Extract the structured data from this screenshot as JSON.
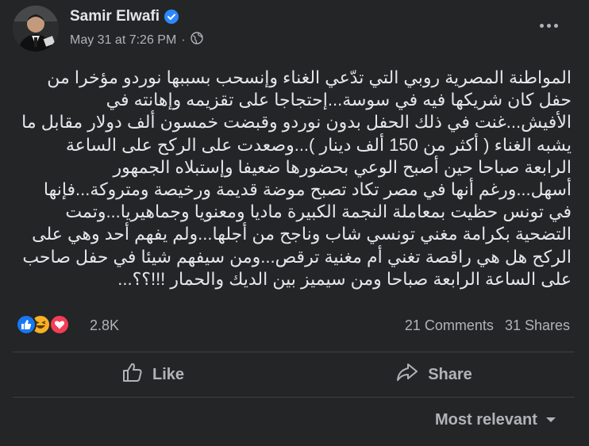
{
  "post": {
    "author": "Samir Elwafi",
    "date": "May 31 at 7:26 PM",
    "separator": "·",
    "text": "المواطنة المصرية روبي التي تدّعي الغناء وإنسحب بسببها نوردو مؤخرا من حفل كان شريكها فيه في سوسة...إحتجاجا على تقزيمه وإهانته في الأفيش...غنت في ذلك الحفل بدون نوردو وقبضت خمسون ألف دولار مقابل ما يشبه الغناء ( أكثر من 150 ألف دينار )...وصعدت على الركح على الساعة الرابعة صباحا حين أصبح الوعي بحضورها ضعيفا وإستبلاه الجمهور أسهل...ورغم أنها في مصر تكاد تصبح موضة قديمة ورخيصة ومتروكة...فإنها في تونس حظيت بمعاملة النجمة الكبيرة ماديا ومعنويا وجماهيريا...وتمت التضحية بكرامة مغني تونسي شاب وناجح من أجلها...ولم يفهم أحد وهي على الركح هل هي راقصة تغني أم مغنية ترقص...ومن سيفهم شيئا في حفل صاحب على الساعة الرابعة صباحا ومن سيميز بين الديك والحمار !!!؟؟..."
  },
  "stats": {
    "reaction_count": "2.8K",
    "comments": "21 Comments",
    "shares": "31 Shares",
    "reactions": [
      "like",
      "haha",
      "love"
    ]
  },
  "actions": {
    "like": "Like",
    "share": "Share"
  },
  "comments_sort": {
    "label": "Most relevant"
  },
  "colors": {
    "background": "#242526",
    "text_primary": "#e4e6eb",
    "text_secondary": "#b0b3b8",
    "verified": "#2d88ff",
    "like_blue": "#1877f2",
    "haha_yellow": "#f7b125",
    "love_red": "#f33e58"
  },
  "icons": [
    "verified-badge-icon",
    "globe-icon",
    "more-options-icon",
    "like-thumb-icon",
    "share-arrow-icon",
    "caret-down-icon"
  ]
}
